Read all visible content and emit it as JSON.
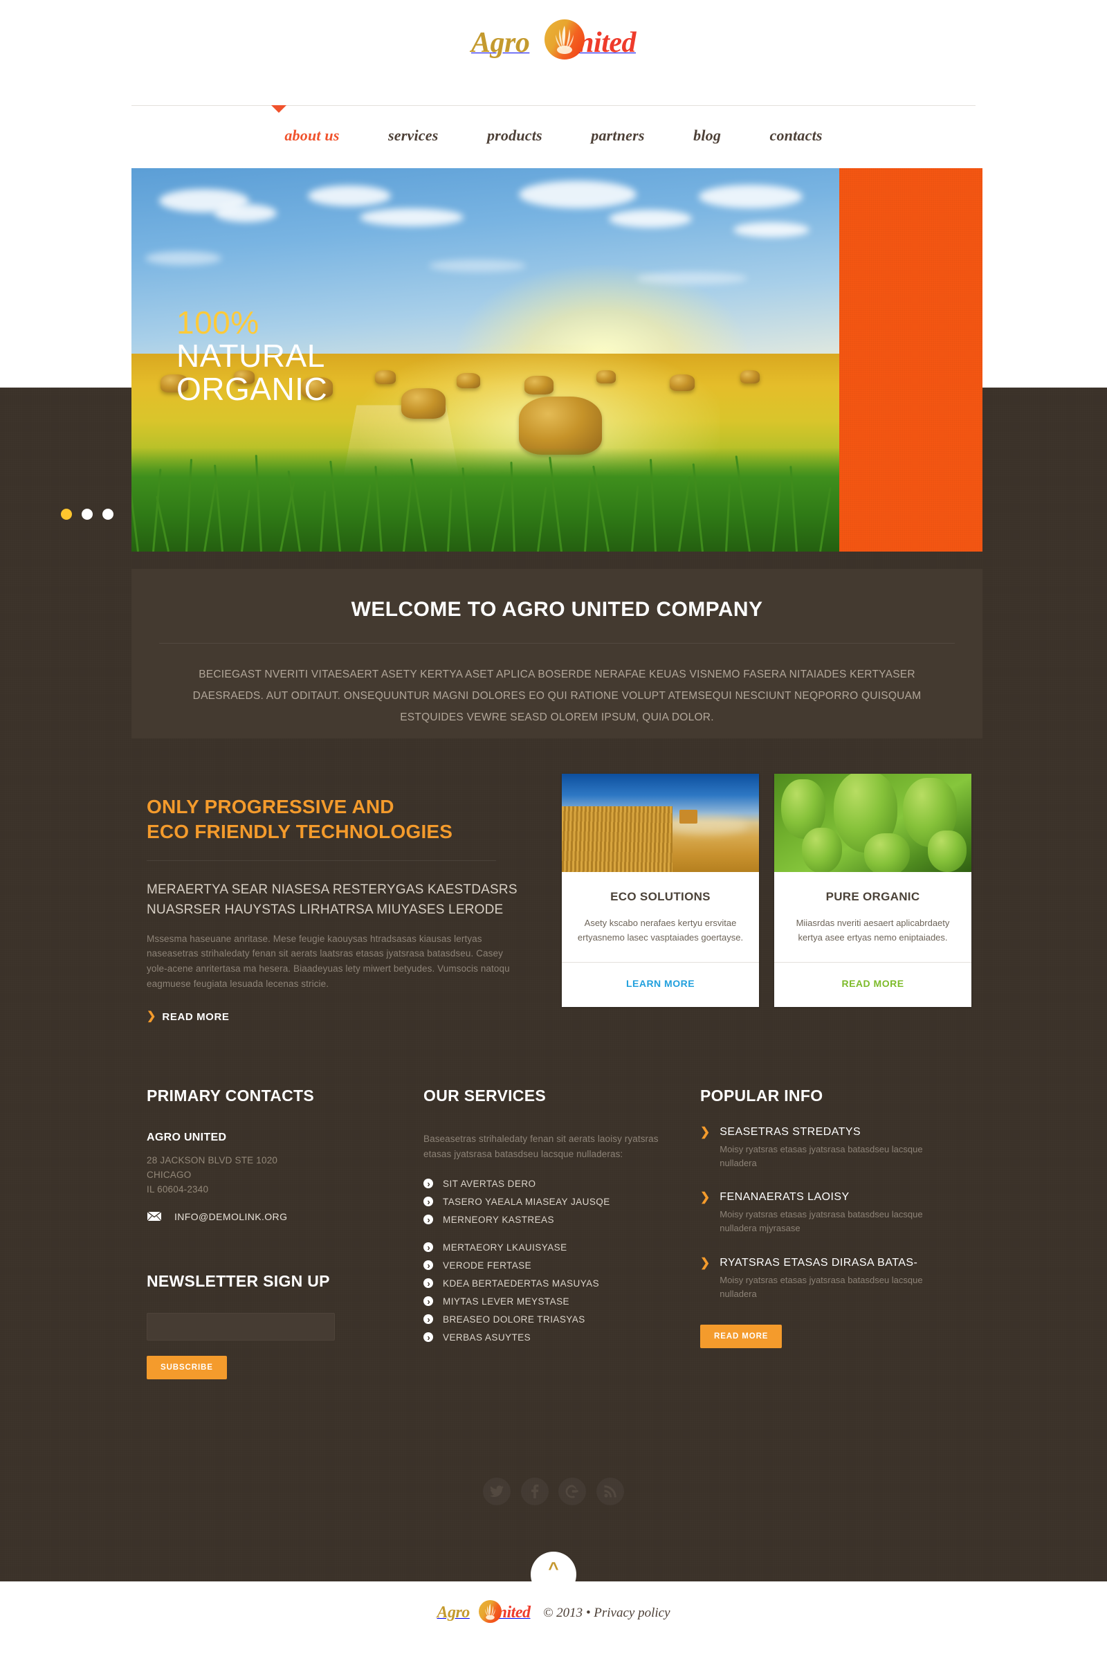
{
  "brand": {
    "part1": "Agro",
    "part2": "United",
    "seal_icon": "wheat-flame-seal"
  },
  "nav": {
    "items": [
      {
        "label": "about us",
        "active": true
      },
      {
        "label": "services",
        "active": false
      },
      {
        "label": "products",
        "active": false
      },
      {
        "label": "partners",
        "active": false
      },
      {
        "label": "blog",
        "active": false
      },
      {
        "label": "contacts",
        "active": false
      }
    ]
  },
  "hero": {
    "image_alt": "hay-bales-golden-field",
    "caption_line1": "100%",
    "caption_line2": "NATURAL",
    "caption_line3": "ORGANIC",
    "accent_color": "#f45612",
    "caption_highlight_color": "#ffca3a",
    "dots": [
      {
        "active": true
      },
      {
        "active": false
      },
      {
        "active": false
      }
    ]
  },
  "welcome": {
    "title": "WELCOME TO AGRO UNITED COMPANY",
    "body": "BECIEGAST NVERITI VITAESAERT ASETY KERTYA ASET APLICA BOSERDE NERAFAE KEUAS VISNEMO FASERA NITAIADES KERTYASER DAESRAEDS. AUT ODITAUT. ONSEQUUNTUR MAGNI DOLORES EO QUI RATIONE VOLUPT ATEMSEQUI NESCIUNT NEQPORRO QUISQUAM ESTQUIDES VEWRE SEASD OLOREM IPSUM, QUIA DOLOR."
  },
  "intro": {
    "heading_line1": "ONLY PROGRESSIVE AND",
    "heading_line2": "ECO FRIENDLY TECHNOLOGIES",
    "subheading": "MERAERTYA SEAR NIASESA RESTERYGAS KAESTDASRS NUASRSER HAUYSTAS LIRHATRSA MIUYASES LERODE",
    "body": "Mssesma haseuane anritase. Mese feugie kaouysas htradsasas kiausas lertyas naseasetras strihaledaty fenan sit aerats laatsras etasas jyatsrasa batasdseu. Casey yole-acene anritertasa ma hesera. Biaadeyuas lety miwert betyudes. Vumsocis natoqu eagmuese feugiata lesuada lecenas stricie.",
    "read_more": "READ MORE"
  },
  "cards": [
    {
      "image_alt": "wheat-field-harvester",
      "title": "ECO SOLUTIONS",
      "text": "Asety kscabo nerafaes kertyu ersvitae ertyasnemo lasec vasptaiades goertayse.",
      "link": "LEARN MORE",
      "link_color": "#22a0dd"
    },
    {
      "image_alt": "green-hop-cones",
      "title": "PURE ORGANIC",
      "text": "Miiasrdas nveriti aesaert aplicabrdaety kertya asee ertyas nemo eniptaiades.",
      "link": "READ MORE",
      "link_color": "#7dbb2a"
    }
  ],
  "footer": {
    "contacts": {
      "title": "PRIMARY CONTACTS",
      "org": "AGRO UNITED",
      "address_line1": "28 JACKSON BLVD STE 1020",
      "address_line2": "CHICAGO",
      "address_line3": "IL 60604-2340",
      "email_icon": "envelope-icon",
      "email": "INFO@DEMOLINK.ORG"
    },
    "newsletter": {
      "title": "NEWSLETTER SIGN UP",
      "input_value": "",
      "input_placeholder": "",
      "button": "SUBSCRIBE"
    },
    "services": {
      "title": "OUR SERVICES",
      "intro": "Baseasetras strihaledaty fenan sit aerats laoisy ryatsras etasas jyatsrasa batasdseu lacsque nulladeras:",
      "group1": [
        "SIT AVERTAS DERO",
        "TASERO YAEALA MIASEAY JAUSQE",
        "MERNEORY KASTREAS"
      ],
      "group2": [
        "MERTAEORY LKAUISYASE",
        "VERODE FERTASE",
        "KDEA BERTAEDERTAS MASUYAS",
        "MIYTAS LEVER MEYSTASE",
        "BREASEO DOLORE TRIASYAS",
        "VERBAS ASUYTES"
      ]
    },
    "popular": {
      "title": "POPULAR INFO",
      "items": [
        {
          "title": "SEASETRAS STREDATYS",
          "desc": "Moisy ryatsras etasas jyatsrasa batasdseu lacsque nulladera"
        },
        {
          "title": "FENANAERATS LAOISY",
          "desc": "Moisy ryatsras etasas jyatsrasa batasdseu lacsque nulladera mjyrasase"
        },
        {
          "title": "RYATSRAS ETASAS DIRASA BATAS-",
          "desc": "Moisy ryatsras etasas jyatsrasa batasdseu lacsque nulladera"
        }
      ],
      "button": "READ MORE"
    },
    "social": [
      {
        "name": "twitter-icon"
      },
      {
        "name": "facebook-icon"
      },
      {
        "name": "google-icon"
      },
      {
        "name": "rss-icon"
      }
    ],
    "to_top_icon": "chevron-up-icon",
    "copyright": "© 2013 •",
    "privacy": "Privacy policy"
  }
}
